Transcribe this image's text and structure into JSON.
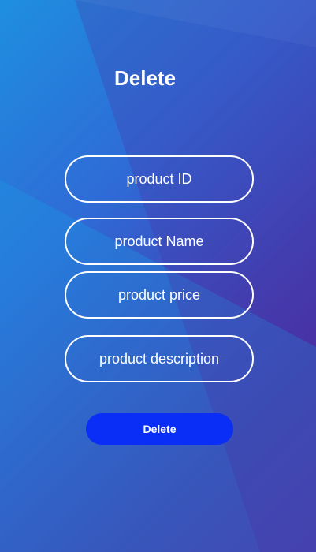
{
  "screen": {
    "title": "Delete"
  },
  "form": {
    "fields": [
      {
        "label": "product ID"
      },
      {
        "label": "product Name"
      },
      {
        "label": "product price"
      },
      {
        "label": "product description"
      }
    ],
    "submit_label": "Delete"
  },
  "colors": {
    "gradient_start": "#1e8fe0",
    "gradient_end": "#5b1e9a",
    "button": "#0a2ef5",
    "text": "#ffffff",
    "field_border": "#ffffff"
  }
}
